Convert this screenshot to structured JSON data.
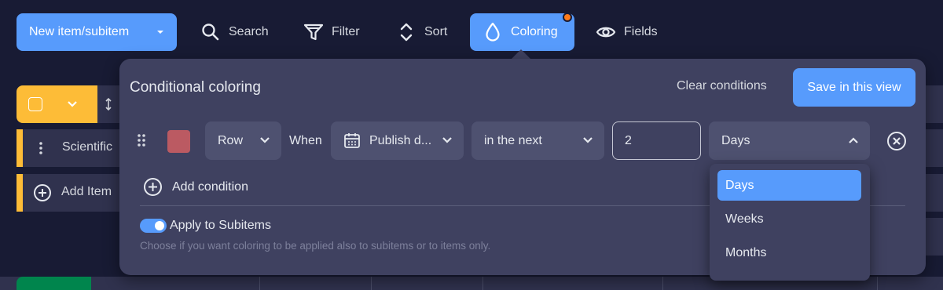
{
  "toolbar": {
    "new_item_label": "New item/subitem",
    "search_label": "Search",
    "filter_label": "Filter",
    "sort_label": "Sort",
    "coloring_label": "Coloring",
    "fields_label": "Fields"
  },
  "board": {
    "row_1_label": "Scientific",
    "add_item_label": "Add Item"
  },
  "popover": {
    "title": "Conditional coloring",
    "clear_label": "Clear conditions",
    "save_label": "Save in this view",
    "condition": {
      "target": "Row",
      "when_label": "When",
      "field": "Publish d...",
      "operator": "in the next",
      "value": "2",
      "unit": "Days",
      "color": "#bb5a62"
    },
    "add_condition_label": "Add condition",
    "apply_subitems_label": "Apply to Subitems",
    "apply_subitems_enabled": true,
    "help_text": "Choose if you want coloring to be applied also to subitems or to items only."
  },
  "unit_dropdown": {
    "options": [
      "Days",
      "Weeks",
      "Months"
    ],
    "selected": "Days"
  },
  "colors": {
    "accent": "#579bfc",
    "group": "#fdbc37",
    "notification": "#ff7a1a"
  }
}
